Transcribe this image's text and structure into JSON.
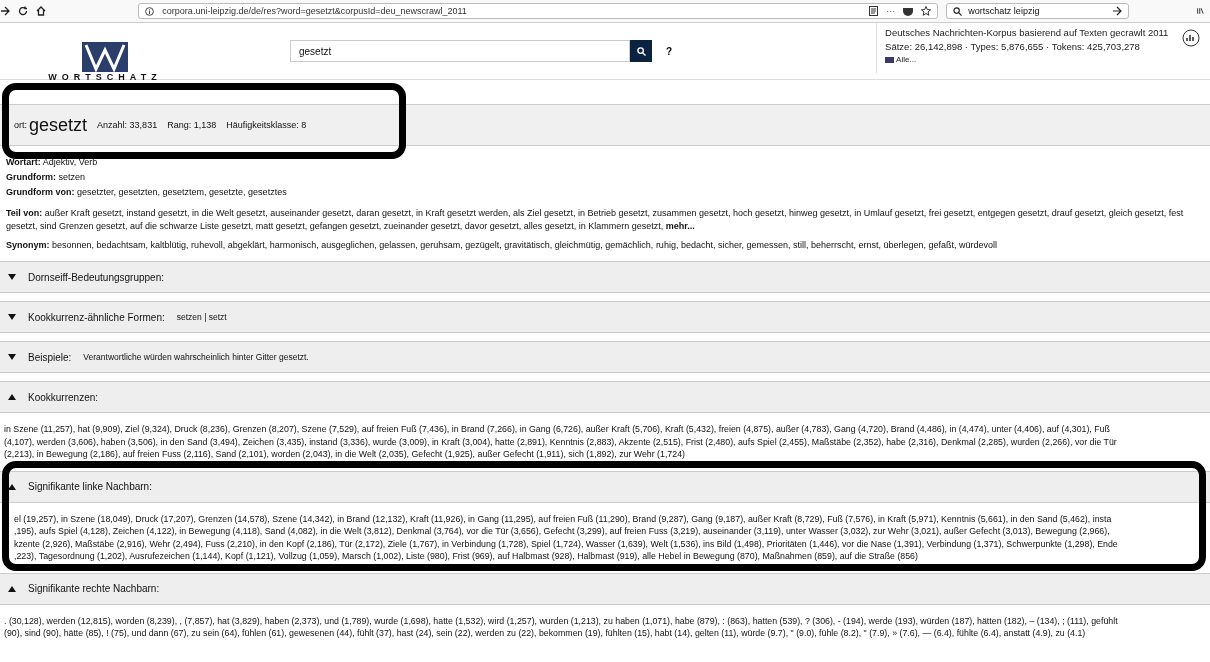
{
  "browser": {
    "url": "corpora.uni-leipzig.de/de/res?word=gesetzt&corpusId=deu_newscrawl_2011",
    "menu": "···",
    "search": "wortschatz leipzig"
  },
  "header": {
    "logo": "WORTSCHATZ",
    "search_value": "gesetzt",
    "help": "?",
    "corpus_title": "Deutsches Nachrichten-Korpus basierend auf Texten gecrawlt 2011",
    "corpus_stats": "Sätze: 26,142,898 · Types: 5,876,655 · Tokens: 425,703,278",
    "all_link": "Alle..."
  },
  "word_bar": {
    "label": "ort:",
    "word": "gesetzt",
    "stats": [
      {
        "label": "Anzahl:",
        "value": "33,831"
      },
      {
        "label": "Rang:",
        "value": "1,138"
      },
      {
        "label": "Häufigkeitsklasse:",
        "value": "8"
      }
    ],
    "highlighted": true
  },
  "details": [
    {
      "label": "Wortart:",
      "value": "Adjektiv, Verb"
    },
    {
      "label": "Grundform:",
      "value": "setzen"
    },
    {
      "label": "Grundform von:",
      "value": "gesetzter, gesetzten, gesetztem, gesetzte, gesetztes"
    }
  ],
  "teil_von": {
    "label": "Teil von:",
    "text": "außer Kraft gesetzt, instand gesetzt, in die Welt gesetzt, auseinander gesetzt, daran gesetzt, in Kraft gesetzt werden, als Ziel gesetzt, in Betrieb gesetzt, zusammen gesetzt, hoch gesetzt, hinweg gesetzt, in Umlauf gesetzt, frei gesetzt, entgegen gesetzt, drauf gesetzt, gleich gesetzt, fest gesetzt, sind Grenzen gesetzt, auf die schwarze Liste gesetzt, matt gesetzt, gefangen gesetzt, zueinander gesetzt, davor gesetzt, alles gesetzt, in Klammern gesetzt, **mehr...**"
  },
  "synonym": {
    "label": "Synonym:",
    "text": "besonnen, bedachtsam, kaltblütig, ruhevoll, abgeklärt, harmonisch, ausgeglichen, gelassen, geruhsam, gezügelt, gravitätisch, gleichmütig, gemächlich, ruhig, bedacht, sicher, gemessen, still, beherrscht, ernst, überlegen, gefaßt, würdevoll"
  },
  "sections": [
    {
      "title": "Dornseiff-Bedeutungsgruppen:",
      "expanded": false,
      "highlighted": false
    },
    {
      "title": "Kookkurrenz-ähnliche Formen:",
      "extra": "setzen | setzt",
      "expanded": false,
      "highlighted": false
    },
    {
      "title": "Beispiele:",
      "extra": "Verantwortliche würden wahrscheinlich hinter Gitter gesetzt.",
      "expanded": false,
      "highlighted": false
    },
    {
      "title": "Kookkurrenzen:",
      "expanded": true,
      "highlighted": false,
      "lines": [
        "in Szene (11,257), hat (9,909), Ziel (9,324), Druck (8,236), Grenzen (8,207), Szene (7,529), auf freien Fuß (7,436), in Brand (7,266), in Gang (6,726), außer Kraft (5,706), Kraft (5,432), freien (4,875), außer (4,783), Gang (4,720), Brand (4,486), in (4,474), unter (4,406), auf (4,301), Fuß",
        "(4,107), werden (3,606), haben (3,506), in den Sand (3,494), Zeichen (3,435), instand (3,336), wurde (3,009), in Kraft (3,004), hatte (2,891), Kenntnis (2,883), Akzente (2,515), Frist (2,480), aufs Spiel (2,455), Maßstäbe (2,352), habe (2,316), Denkmal (2,285), wurden (2,266), vor die Tür",
        "(2,213), in Bewegung (2,186), auf freien Fuss (2,116), Sand (2,101), worden (2,043), in die Welt (2,035), Gefecht (1,925), außer Gefecht (1,911), sich (1,892), zur Wehr (1,724)"
      ]
    },
    {
      "title": "Signifikante linke Nachbarn:",
      "expanded": true,
      "highlighted": true,
      "lines": [
        "el (19,257), in Szene (18,049), Druck (17,207), Grenzen (14,578), Szene (14,342), in Brand (12,132), Kraft (11,926), in Gang (11,295), auf freien Fuß (11,290), Brand (9,287), Gang (9,187), außer Kraft (8,729), Fuß (7,576), in Kraft (5,971), Kenntnis (5,661), in den Sand (5,462), insta",
        ",195), aufs Spiel (4,128), Zeichen (4,122), in Bewegung (4,118), Sand (4,082), in die Welt (3,812), Denkmal (3,764), vor die Tür (3,656), Gefecht (3,299), auf freien Fuss (3,219), auseinander (3,119), unter Wasser (3,032), zur Wehr (3,021), außer Gefecht (3,013), Bewegung (2,966),",
        "kzente (2,926), Maßstäbe (2,916), Wehr (2,494), Fuss (2,210), in den Kopf (2,186), Tür (2,172), Ziele (1,767), in Verbindung (1,728), Spiel (1,724), Wasser (1,639), Welt (1,536), ins Bild (1,498), Prioritäten (1,446), vor die Nase (1,391), Verbindung (1,371), Schwerpunkte (1,298), Ende",
        ",223), Tagesordnung (1,202), Ausrufezeichen (1,144), Kopf (1,121), Vollzug (1,059), Marsch (1,002), Liste (980), Frist (969), auf Halbmast (928), Halbmast (919), alle Hebel in Bewegung (870), Maßnahmen (859), auf die Straße (856)"
      ]
    },
    {
      "title": "Signifikante rechte Nachbarn:",
      "expanded": true,
      "highlighted": false,
      "lines": [
        ". (30,128), werden (12,815), worden (8,239), , (7,857), hat (3,829), haben (2,373), und (1,789), wurde (1,698), hatte (1,532), wird (1,257), wurden (1,213), zu haben (1,071), habe (879), : (863), hatten (539), ? (306), - (194), werde (193), würden (187), hätten (182), – (134), ; (111), gefühlt",
        "(90), sind (90), hätte (85), ! (75), und dann (67), zu sein (64), fühlen (61), gewesenen (44), fühlt (37), hast (24), sein (22), werden zu (22), bekommen (19), fühlten (15), habt (14), gelten (11), würde (9.7), \" (9.0), fühle (8.2), \" (7.9), » (7.6), — (6.4), fühlte (6.4), anstatt (4.9), zu (4.1)"
      ]
    }
  ]
}
